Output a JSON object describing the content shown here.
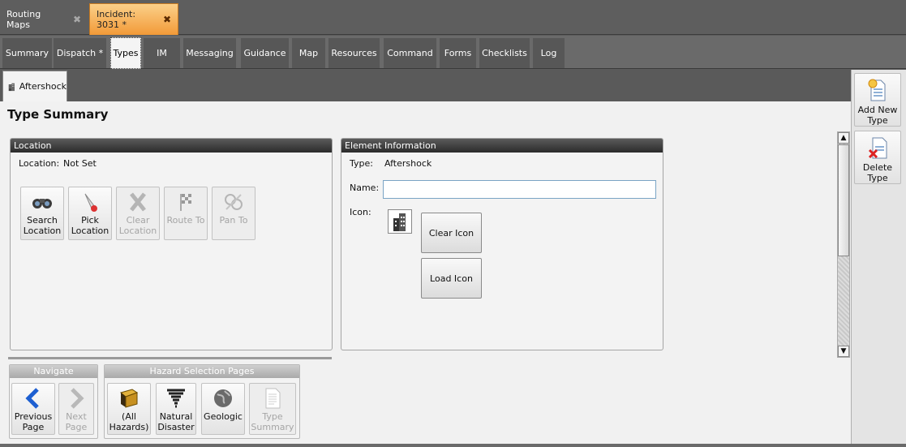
{
  "doc_tabs": [
    {
      "label": "Routing Maps",
      "close": "✖"
    },
    {
      "label": "Incident: 3031 *",
      "close": "✖"
    }
  ],
  "nav_tabs": [
    "Summary",
    "Dispatch *",
    "Types",
    "IM",
    "Messaging",
    "Guidance",
    "Map",
    "Resources",
    "Command",
    "Forms",
    "Checklists",
    "Log"
  ],
  "active_nav_tab": "Types",
  "sub_tab": {
    "label": "Aftershock",
    "icon": "building-icon"
  },
  "page_title": "Type Summary",
  "location_panel": {
    "title": "Location",
    "location_label": "Location:",
    "location_value": "Not Set",
    "buttons": [
      {
        "label": "Search\nLocation",
        "icon": "binoculars-icon",
        "enabled": true
      },
      {
        "label": "Pick\nLocation",
        "icon": "pointer-pick-icon",
        "enabled": true
      },
      {
        "label": "Clear\nLocation",
        "icon": "clear-x-icon",
        "enabled": false
      },
      {
        "label": "Route To",
        "icon": "checkered-flag-icon",
        "enabled": false
      },
      {
        "label": "Pan To",
        "icon": "pan-icon",
        "enabled": false
      }
    ]
  },
  "element_panel": {
    "title": "Element Information",
    "type_label": "Type:",
    "type_value": "Aftershock",
    "name_label": "Name:",
    "name_value": "",
    "icon_label": "Icon:",
    "clear_icon_label": "Clear Icon",
    "load_icon_label": "Load Icon"
  },
  "right_panel": {
    "add_label": "Add New\nType",
    "delete_label": "Delete\nType"
  },
  "navigate_group": {
    "title": "Navigate",
    "previous_label": "Previous\nPage",
    "next_label": "Next\nPage"
  },
  "hazard_group": {
    "title": "Hazard Selection Pages",
    "buttons": [
      {
        "label": "(All\nHazards)",
        "icon": "book-icon",
        "enabled": true
      },
      {
        "label": "Natural\nDisaster",
        "icon": "tornado-icon",
        "enabled": true
      },
      {
        "label": "Geologic",
        "icon": "globe-icon",
        "enabled": true
      },
      {
        "label": "Type\nSummary",
        "icon": "document-icon",
        "enabled": false
      }
    ]
  },
  "colors": {
    "active_doc_tab": "#f29a38",
    "panel_header": "#2b2b2b",
    "input_border": "#7aa4c5"
  }
}
